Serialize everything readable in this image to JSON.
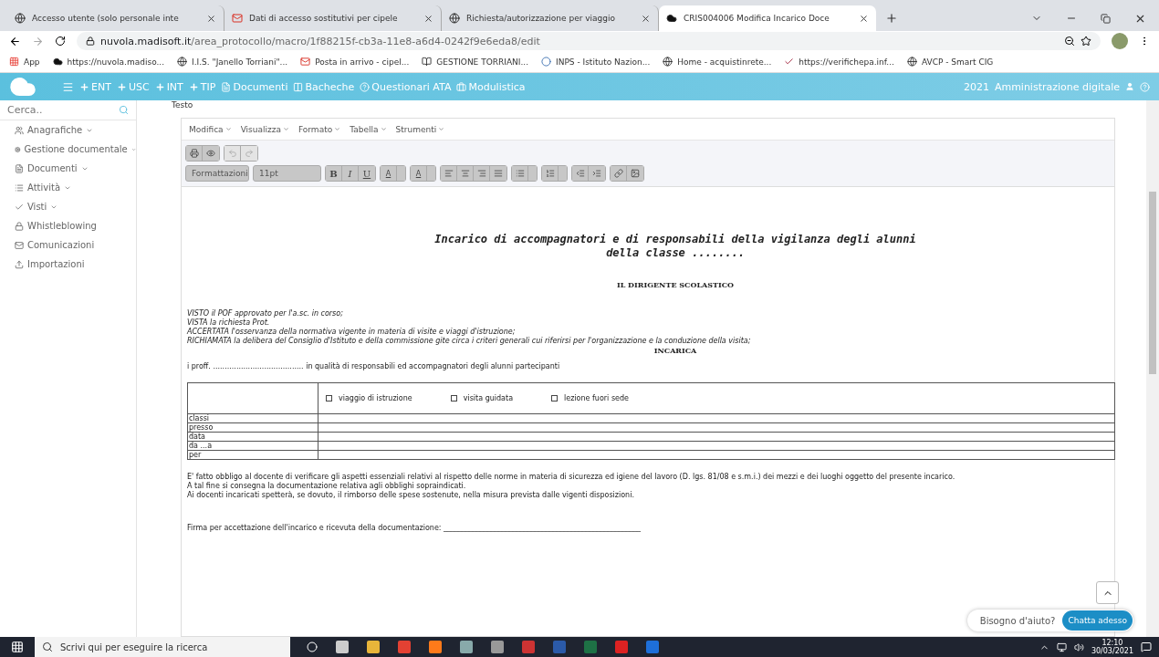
{
  "browser": {
    "tabs": [
      {
        "title": "Accesso utente (solo personale inte",
        "selected": false
      },
      {
        "title": "Dati di accesso sostitutivi per cipele",
        "selected": false
      },
      {
        "title": "Richiesta/autorizzazione per viaggio",
        "selected": false
      },
      {
        "title": "CRIS004006 Modifica Incarico Doce",
        "selected": true
      }
    ],
    "url_host": "nuvola.madisoft.it",
    "url_path": "/area_protocollo/macro/1f88215f-cb3a-11e8-a6d4-0242f9e6eda8/edit",
    "bookmarks": [
      "App",
      "https://nuvola.madiso...",
      "I.I.S. \"Janello Torriani\"...",
      "Posta in arrivo - cipel...",
      "GESTIONE TORRIANI...",
      "INPS - Istituto Nazion...",
      "Home - acquistinrete...",
      "https://verifichepa.inf...",
      "AVCP - Smart CIG"
    ]
  },
  "header": {
    "nav": [
      "ENT",
      "USC",
      "INT",
      "TIP",
      "Documenti",
      "Bacheche",
      "Questionari ATA",
      "Modulistica"
    ],
    "year": "2021",
    "area": "Amministrazione digitale"
  },
  "sidebar": {
    "search": {
      "placeholder": "Cerca.."
    },
    "items": [
      {
        "label": "Anagrafiche",
        "kind": "menu"
      },
      {
        "label": "Gestione documentale",
        "kind": "menu"
      },
      {
        "label": "Documenti",
        "kind": "menu"
      },
      {
        "label": "Attività",
        "kind": "menu"
      },
      {
        "label": "Visti",
        "kind": "menu"
      },
      {
        "label": "Whistleblowing",
        "kind": "link"
      },
      {
        "label": "Comunicazioni",
        "kind": "link"
      },
      {
        "label": "Importazioni",
        "kind": "link"
      }
    ]
  },
  "editor": {
    "label": "Testo",
    "menus": [
      "Modifica",
      "Visualizza",
      "Formato",
      "Tabella",
      "Strumenti"
    ],
    "undo_disabled": true,
    "redo_disabled": true,
    "format_select": "Formattazioni",
    "size_select": "11pt",
    "text_buttons": [
      "B",
      "I",
      "U"
    ],
    "color_buttons": [
      "A",
      "A"
    ]
  },
  "document": {
    "title_lines": [
      "Incarico di accompagnatori e di responsabili della vigilanza degli alunni",
      "della classe ........"
    ],
    "heading": "IL DIRIGENTE SCOLASTICO",
    "premises": [
      "VISTO il POF approvato per l'a.sc. in corso;",
      "VISTA la richiesta Prot.",
      "ACCERTATA l'osservanza della normativa vigente in materia di visite e viaggi d'istruzione;",
      "RICHIAMATA la delibera del Consiglio d'Istituto e della commissione gite circa i criteri generali cui riferirsi per l'organizzazione e la conduzione della visita;"
    ],
    "decision": "INCARICA",
    "assignment": "i proff. ....................................... in qualità di responsabili ed accompagnatori degli alunni partecipanti",
    "options": [
      {
        "label": "viaggio di istruzione",
        "checked": false
      },
      {
        "label": "visita guidata",
        "checked": false
      },
      {
        "label": "lezione fuori sede",
        "checked": false
      }
    ],
    "row_labels": [
      "classi",
      "presso",
      "data",
      "da ...a",
      "per"
    ],
    "notes": [
      " E' fatto obbligo al docente di verificare gli aspetti essenziali relativi al rispetto delle norme in materia di sicurezza ed igiene del lavoro (D. lgs. 81/08 e s.m.i.) dei mezzi e dei luoghi oggetto del presente incarico.",
      "A tal fine si consegna la documentazione relativa agli obblighi sopraindicati.",
      "Ai docenti incaricati spetterà, se dovuto, il rimborso delle spese sostenute, nella misura prevista dalle vigenti disposizioni."
    ],
    "signature": "Firma per accettazione dell'incarico e ricevuta della documentazione: ______________________________________________________"
  },
  "help": {
    "question": "Bisogno d'aiuto?",
    "button": "Chatta adesso"
  },
  "taskbar": {
    "search": {
      "placeholder": "Scrivi qui per eseguire la ricerca"
    },
    "time": "12:10",
    "date": "30/03/2021"
  }
}
